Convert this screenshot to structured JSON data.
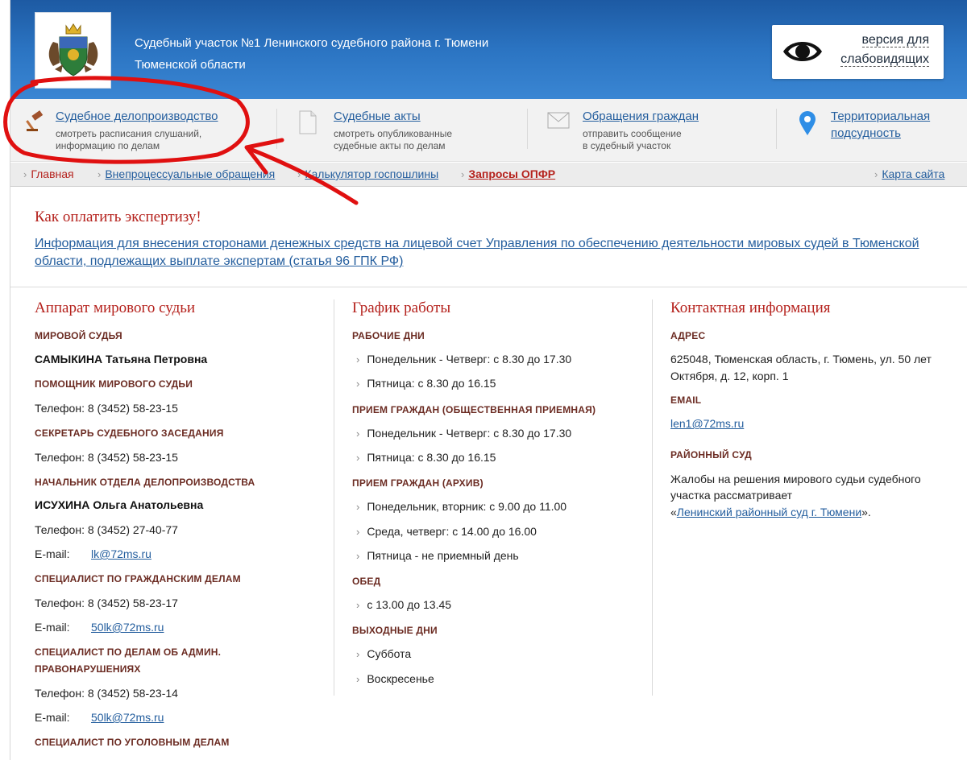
{
  "header": {
    "title_line1": "Судебный участок №1 Ленинского судебного района г. Тюмени",
    "title_line2": "Тюменской области",
    "vision_line1": "версия для",
    "vision_line2": "слабовидящих"
  },
  "menu": [
    {
      "title": "Судебное делопроизводство",
      "sub1": "смотреть расписания слушаний,",
      "sub2": "информацию по делам"
    },
    {
      "title": "Судебные акты",
      "sub1": "смотреть опубликованные",
      "sub2": "судебные акты по делам"
    },
    {
      "title": "Обращения граждан",
      "sub1": "отправить сообщение",
      "sub2": "в судебный участок"
    },
    {
      "title1": "Территориальная",
      "title2": "подсудность"
    }
  ],
  "subnav": {
    "home": "Главная",
    "item1": "Внепроцессуальные обращения",
    "item2": "Калькулятор госпошлины",
    "item3": "Запросы ОПФР",
    "sitemap": "Карта сайта",
    "arrow": "›"
  },
  "notice": {
    "title": "Как оплатить экспертизу!",
    "link": "Информация для внесения сторонами денежных средств на лицевой счет Управления по обеспечению деятельности мировых судей в Тюменской области, подлежащих выплате экспертам (статья 96 ГПК РФ)"
  },
  "staff": {
    "title": "Аппарат мирового судьи",
    "judge_label": "МИРОВОЙ СУДЬЯ",
    "judge_name": "САМЫКИНА Татьяна Петровна",
    "assistant_label": "ПОМОЩНИК МИРОВОГО СУДЬИ",
    "assistant_phone": "Телефон:  8 (3452) 58-23-15",
    "secretary_label": "СЕКРЕТАРЬ СУДЕБНОГО ЗАСЕДАНИЯ",
    "secretary_phone": "Телефон:  8 (3452) 58-23-15",
    "head_label": "НАЧАЛЬНИК ОТДЕЛА ДЕЛОПРОИЗВОДСТВА",
    "head_name": "ИСУХИНА Ольга Анатольевна",
    "head_phone": "Телефон:  8 (3452) 27-40-77",
    "email_key": "E-mail:",
    "head_email": "lk@72ms.ru",
    "civil_label": "СПЕЦИАЛИСТ ПО ГРАЖДАНСКИМ ДЕЛАМ",
    "civil_phone": "Телефон:  8 (3452) 58-23-17",
    "civil_email": "50lk@72ms.ru",
    "admin_label1": "СПЕЦИАЛИСТ ПО ДЕЛАМ ОБ АДМИН.",
    "admin_label2": "ПРАВОНАРУШЕНИЯХ",
    "admin_phone": "Телефон:  8 (3452) 58-23-14",
    "admin_email": "50lk@72ms.ru",
    "criminal_label": "СПЕЦИАЛИСТ ПО УГОЛОВНЫМ ДЕЛАМ"
  },
  "schedule": {
    "title": "График работы",
    "workdays_label": "РАБОЧИЕ ДНИ",
    "workdays": [
      "Понедельник - Четверг: с 8.30 до 17.30",
      "Пятница: с 8.30 до 16.15"
    ],
    "reception_label": "ПРИЕМ ГРАЖДАН (ОБЩЕСТВЕННАЯ ПРИЕМНАЯ)",
    "reception": [
      "Понедельник - Четверг: с 8.30 до 17.30",
      "Пятница: с 8.30 до 16.15"
    ],
    "archive_label": "ПРИЕМ ГРАЖДАН (АРХИВ)",
    "archive": [
      "Понедельник, вторник: с 9.00 до 11.00",
      "Среда, четверг: с 14.00 до 16.00",
      "Пятница - не приемный день"
    ],
    "lunch_label": "ОБЕД",
    "lunch": [
      "с 13.00 до 13.45"
    ],
    "weekend_label": "ВЫХОДНЫЕ ДНИ",
    "weekend": [
      "Суббота",
      "Воскресенье"
    ],
    "chevron": "›"
  },
  "contacts": {
    "title": "Контактная информация",
    "address_label": "АДРЕС",
    "address1": "625048, Тюменская область, г. Тюмень, ул. 50 лет",
    "address2": "Октября, д. 12, корп. 1",
    "email_label": "EMAIL",
    "email": "len1@72ms.ru",
    "court_label": "РАЙОННЫЙ СУД",
    "court1": "Жалобы на решения мирового судьи судебного",
    "court2": "участка рассматривает",
    "court_open": "«",
    "court_link": "Ленинский районный суд г. Тюмени",
    "court_close": "»."
  },
  "colors": {
    "header": "#2b74c2",
    "link": "#245e9e",
    "accent_red": "#b5221d",
    "annotation": "#e01010"
  }
}
